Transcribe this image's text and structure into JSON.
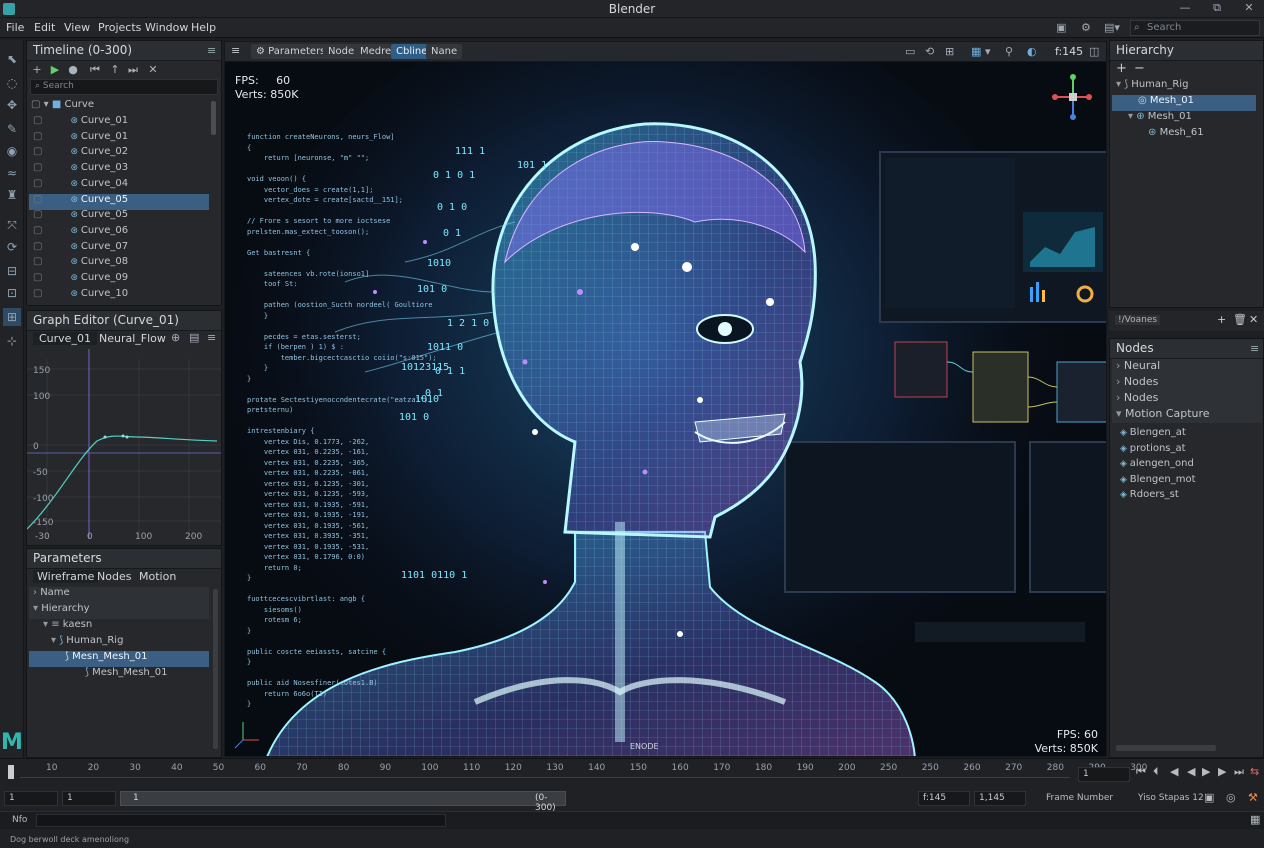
{
  "window": {
    "title": "Blender",
    "minimize": "—",
    "restore": "⧉",
    "close": "✕"
  },
  "menu": [
    "File",
    "Edit",
    "View",
    "Projects",
    "Window",
    "Help"
  ],
  "top_search": {
    "placeholder": "Search"
  },
  "timeline_panel": {
    "title": "Timeline (0-300)",
    "search_placeholder": "Search",
    "folder": "Curve",
    "items": [
      "Curve_01",
      "Curve_01",
      "Curve_02",
      "Curve_03",
      "Curve_04",
      "Curve_05",
      "Curve_05",
      "Curve_06",
      "Curve_07",
      "Curve_08",
      "Curve_09",
      "Curve_10"
    ],
    "selected_index": 5
  },
  "graph_editor": {
    "title": "Graph Editor (Curve_01)",
    "tabs": [
      "Curve_01",
      "Neural_Flow"
    ],
    "y_ticks": [
      "150",
      "100",
      "0",
      "-50",
      "-100",
      "-150"
    ],
    "x_ticks": [
      "-30",
      "0",
      "100",
      "200"
    ]
  },
  "parameters_panel": {
    "title": "Parameters",
    "tabs": [
      "Wireframe",
      "Nodes",
      "Motion"
    ],
    "rows": [
      "Name",
      "Hierarchy",
      "kaesn",
      "Human_Rig",
      "Mesn_Mesh_01",
      "Mesh_Mesh_01"
    ],
    "selected_index": 4
  },
  "viewport": {
    "toolbar": [
      "Parameters",
      "Node",
      "Medre",
      "Cbline",
      "Nane"
    ],
    "active_chip": 3,
    "frame": "f:145",
    "fps_label": "FPS:",
    "fps_value": "60",
    "verts": "Verts: 850K",
    "fps_br": "FPS: 60",
    "verts_br": "Verts: 850K",
    "bottom_center": "ENODE",
    "code_lines": [
      "function createNeurons, neurs_Flow]",
      "{",
      "    return [neuronse, \"m\" \"\";",
      "",
      "void veoon() {",
      "    vector_does = create(1,1];",
      "    vertex_dote = create[sactd__151];",
      "",
      "// Frore s sesort to more ioctsese",
      "prelsten.mas_extect_tooson();",
      "",
      "Get bastresnt {",
      "",
      "    sateences vb.rote(ionso1]",
      "    toof St:",
      "",
      "    pathen (oostion_Sucth nordeel( Goultiore",
      "    }",
      "",
      "    pecdes = etas.sesterst;",
      "    if (berpen ) 1) $ :",
      "        tember.bigcectcasctio coiio(\"s:015\");",
      "    }",
      "}",
      "",
      "protate Sectestiyenoccndentecrate(\"eatza1\");",
      "pretsternu)",
      "",
      "intrestenbiary {",
      "    vertex Dis, 0.1773, -262,",
      "    vertex 031, 0.2235, -161,",
      "    vertex 031, 0.2235, -365,",
      "    vertex 031, 0.2235, -061,",
      "    vertex 031, 0.1235, -301,",
      "    vertex 031, 0.1235, -593,",
      "    vertex 031, 0.1935, -591,",
      "    vertex 031, 0.1935, -191,",
      "    vertex 031, 0.1935, -561,",
      "    vertex 031, 0.3935, -351,",
      "    vertex 031, 0.1935, -531,",
      "    vertex 031, 0.1796, 0:0)",
      "    return 0;",
      "}",
      "",
      "fuottcecescvibrtlast: angb {",
      "    siesoms()",
      "    rotesm 6;",
      "}",
      "",
      "public coscte eeiassts, satcine {",
      "}",
      "",
      "public aid Nosesfiner(cotes1.B)",
      "    return 6o6o(TI)",
      "}"
    ],
    "binary": [
      "111 1",
      "0 1 0 1",
      "101 1",
      "0 1 0",
      "0 1",
      "1010",
      "101 0",
      "1 2 1 0",
      "1011 0",
      "0 1 1",
      "0 1",
      "1010",
      "10123115",
      "101 0",
      "1101 0110 1"
    ]
  },
  "hierarchy_panel": {
    "title": "Hierarchy",
    "items": [
      "Human_Rig",
      "Mesh_01",
      "Mesh_01",
      "Mesh_61"
    ],
    "selected_index": 1
  },
  "views_bar": {
    "label": "!/Voanes"
  },
  "nodes_panel": {
    "title": "Nodes",
    "groups": [
      "Neural",
      "Nodes",
      "Nodes",
      "Motion Capture"
    ],
    "items": [
      "Blengen_at",
      "protions_at",
      "alengen_ond",
      "Blengen_mot",
      "Rdoers_st"
    ]
  },
  "timeline_bar": {
    "ticks": [
      "10",
      "20",
      "30",
      "40",
      "50",
      "60",
      "70",
      "80",
      "90",
      "100",
      "110",
      "120",
      "130",
      "140",
      "150",
      "160",
      "170",
      "180",
      "190",
      "200",
      "250",
      "250",
      "260",
      "270",
      "280",
      "290",
      "300"
    ],
    "current_frame": "1",
    "start": "1",
    "end": "1",
    "range_left": "1",
    "range_label": "(0-300)",
    "frame_a": "f:145",
    "frame_b": "1,145",
    "frame_number_label": "Frame Number",
    "steps_label": "Yiso Stapas 12",
    "info_label": "Nfo",
    "status": "Dog berwoll deck amenoliong"
  },
  "accent": "#3a8fd0"
}
